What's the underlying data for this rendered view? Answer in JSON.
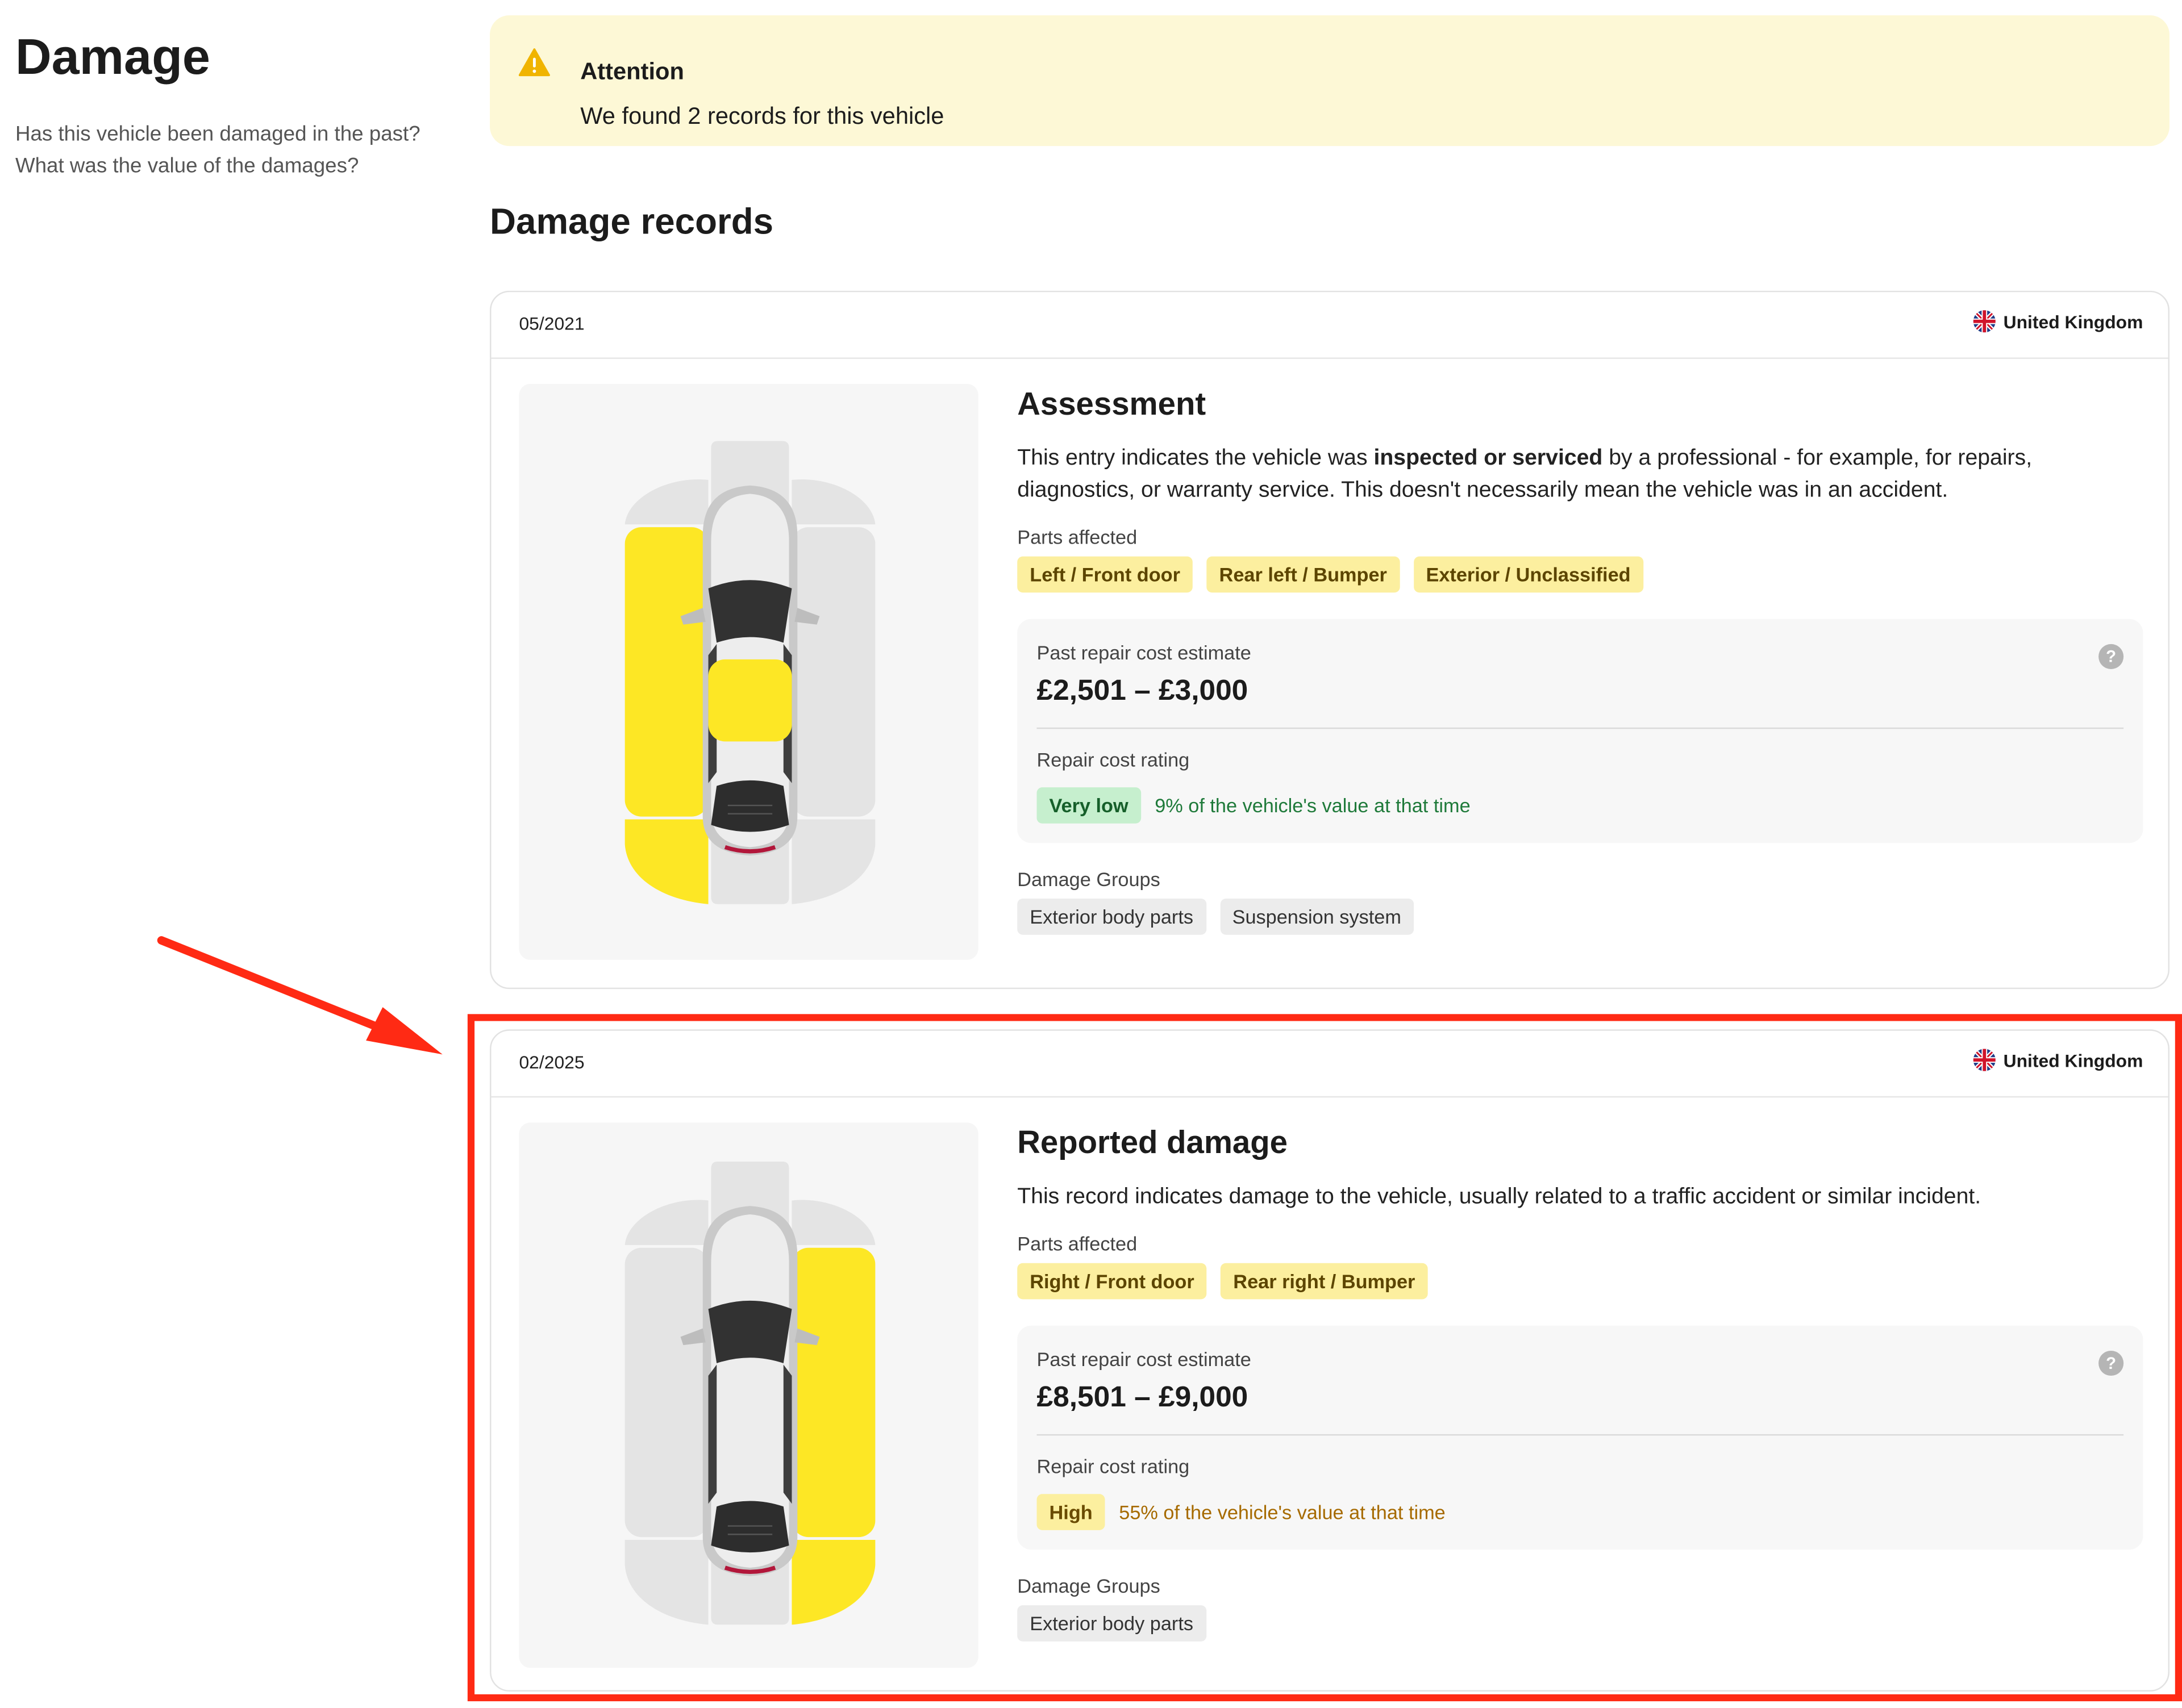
{
  "sidebar": {
    "title": "Damage",
    "description": "Has this vehicle been damaged in the past? What was the value of the damages?"
  },
  "alert": {
    "title": "Attention",
    "text": "We found 2 records for this vehicle",
    "icon": "warning-icon",
    "color": "#fdf8d6"
  },
  "section_title": "Damage records",
  "records": [
    {
      "date": "05/2021",
      "country": "United Kingdom",
      "title": "Assessment",
      "description_pre": "This entry indicates the vehicle was ",
      "description_bold": "inspected or serviced",
      "description_post": " by a professional - for example, for repairs, diagnostics, or warranty service. This doesn't necessarily mean the vehicle was in an accident.",
      "parts_label": "Parts affected",
      "parts": [
        "Left / Front door",
        "Rear left / Bumper",
        "Exterior / Unclassified"
      ],
      "cost_label": "Past repair cost estimate",
      "cost_value": "£2,501 – £3,000",
      "rating_label": "Repair cost rating",
      "rating": "Very low",
      "rating_note": "9% of the vehicle's value at that time",
      "groups_label": "Damage Groups",
      "groups": [
        "Exterior body parts",
        "Suspension system"
      ]
    },
    {
      "date": "02/2025",
      "country": "United Kingdom",
      "title": "Reported damage",
      "description": "This record indicates damage to the vehicle, usually related to a traffic accident or similar incident.",
      "parts_label": "Parts affected",
      "parts": [
        "Right / Front door",
        "Rear right / Bumper"
      ],
      "cost_label": "Past repair cost estimate",
      "cost_value": "£8,501 – £9,000",
      "rating_label": "Repair cost rating",
      "rating": "High",
      "rating_note": "55% of the vehicle's value at that time",
      "groups_label": "Damage Groups",
      "groups": [
        "Exterior body parts"
      ]
    }
  ],
  "help_icon": "?",
  "colors": {
    "damage_yellow": "#fde725",
    "panel_grey": "#e4e4e4",
    "highlight_red": "#ff2a14",
    "badge_green": "#c6efce",
    "badge_yellow": "#fcef9f"
  }
}
